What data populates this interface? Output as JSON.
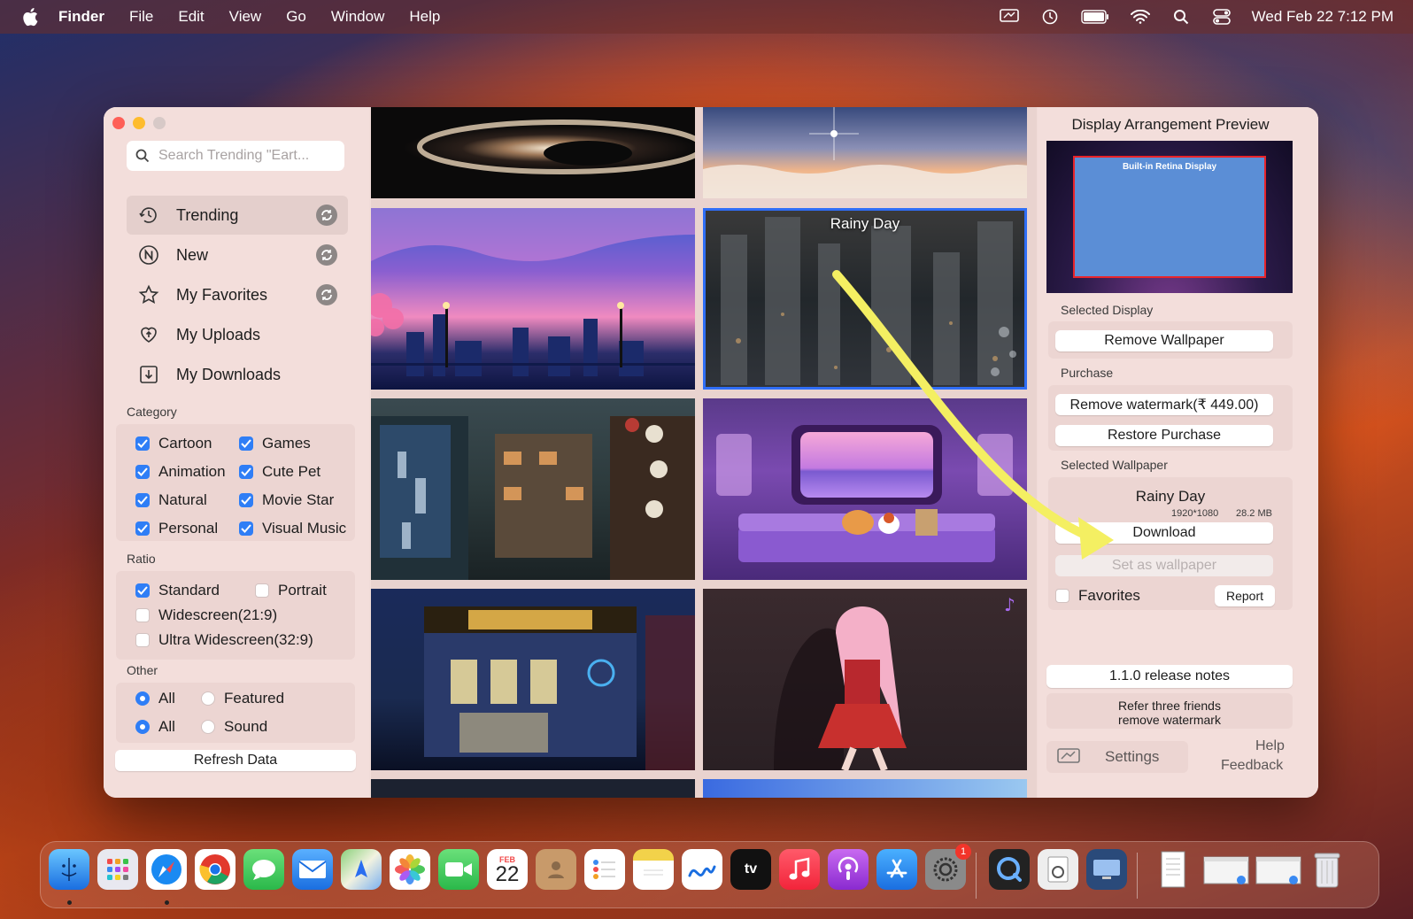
{
  "menubar": {
    "app_name": "Finder",
    "items": [
      "File",
      "Edit",
      "View",
      "Go",
      "Window",
      "Help"
    ],
    "clock": "Wed Feb 22  7:12 PM",
    "status_icons": [
      "screen-mirror-icon",
      "time-machine-icon",
      "battery-icon",
      "wifi-icon",
      "spotlight-icon",
      "control-center-icon"
    ]
  },
  "sidebar": {
    "search_placeholder": "Search Trending \"Eart...",
    "nav": [
      {
        "label": "Trending",
        "icon": "trending-icon",
        "refresh": true,
        "active": true
      },
      {
        "label": "New",
        "icon": "new-icon",
        "refresh": true,
        "active": false
      },
      {
        "label": "My Favorites",
        "icon": "star-icon",
        "refresh": true,
        "active": false
      },
      {
        "label": "My Uploads",
        "icon": "heart-upload-icon",
        "refresh": false,
        "active": false
      },
      {
        "label": "My Downloads",
        "icon": "download-box-icon",
        "refresh": false,
        "active": false
      }
    ],
    "category_label": "Category",
    "categories": [
      {
        "label": "Cartoon",
        "checked": true
      },
      {
        "label": "Games",
        "checked": true
      },
      {
        "label": "Animation",
        "checked": true
      },
      {
        "label": "Cute Pet",
        "checked": true
      },
      {
        "label": "Natural",
        "checked": true
      },
      {
        "label": "Movie Star",
        "checked": true
      },
      {
        "label": "Personal",
        "checked": true
      },
      {
        "label": "Visual Music",
        "checked": true
      }
    ],
    "ratio_label": "Ratio",
    "ratios": [
      {
        "label": "Standard",
        "checked": true
      },
      {
        "label": "Portrait",
        "checked": false
      },
      {
        "label": "Widescreen(21:9)",
        "checked": false
      },
      {
        "label": "Ultra Widescreen(32:9)",
        "checked": false
      }
    ],
    "other_label": "Other",
    "other_row1": [
      {
        "label": "All",
        "selected": true
      },
      {
        "label": "Featured",
        "selected": false
      }
    ],
    "other_row2": [
      {
        "label": "All",
        "selected": true
      },
      {
        "label": "Sound",
        "selected": false
      }
    ],
    "refresh_button": "Refresh Data"
  },
  "grid": {
    "selected_tile_title": "Rainy Day"
  },
  "right_panel": {
    "title": "Display Arrangement Preview",
    "display_name": "Built-in Retina Display",
    "selected_display_label": "Selected Display",
    "remove_wallpaper": "Remove Wallpaper",
    "purchase_label": "Purchase",
    "remove_watermark": "Remove watermark(₹ 449.00)",
    "restore_purchase": "Restore Purchase",
    "selected_wallpaper_label": "Selected Wallpaper",
    "wallpaper_name": "Rainy Day",
    "wallpaper_resolution": "1920*1080",
    "wallpaper_size": "28.2 MB",
    "download": "Download",
    "set_as_wallpaper": "Set as wallpaper",
    "favorites": "Favorites",
    "favorites_checked": false,
    "report": "Report",
    "release_notes": "1.1.0 release notes",
    "refer_line1": "Refer three friends",
    "refer_line2": "remove watermark",
    "settings": "Settings",
    "help": "Help",
    "feedback": "Feedback"
  },
  "dock": {
    "calendar_month": "FEB",
    "calendar_day": "22",
    "settings_badge": "1",
    "apps": [
      "finder-icon",
      "launchpad-icon",
      "safari-icon",
      "chrome-icon",
      "messages-icon",
      "mail-icon",
      "maps-icon",
      "photos-icon",
      "facetime-icon",
      "calendar-icon",
      "contacts-icon",
      "reminders-icon",
      "notes-icon",
      "freeform-icon",
      "apple-tv-icon",
      "music-icon",
      "podcasts-icon",
      "app-store-icon",
      "system-settings-icon",
      "quicktime-icon",
      "preview-icon",
      "screen-sharing-icon",
      "document-icon",
      "window-icon-1",
      "window-icon-2",
      "trash-icon"
    ]
  }
}
